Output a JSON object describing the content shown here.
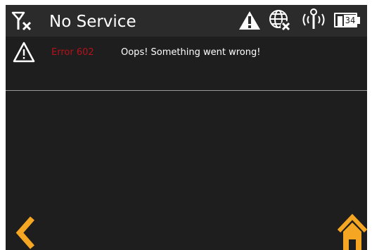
{
  "status_bar": {
    "title": "No Service",
    "icons": [
      "no-signal-icon",
      "warning-icon",
      "globe-disabled-icon",
      "wireless-broadcast-icon",
      "battery-icon"
    ],
    "battery_level": "34"
  },
  "error": {
    "icon": "warning-outline-icon",
    "code": "Error 602",
    "message": "Oops! Something went wrong!"
  },
  "nav": {
    "back_icon": "chevron-left-icon",
    "home_icon": "home-icon"
  },
  "colors": {
    "background": "#1e1e1e",
    "status_bar": "#2b2b2b",
    "error_code": "#b5121b",
    "accent": "#f5a623",
    "text": "#ffffff",
    "divider": "#9a9a9a"
  }
}
